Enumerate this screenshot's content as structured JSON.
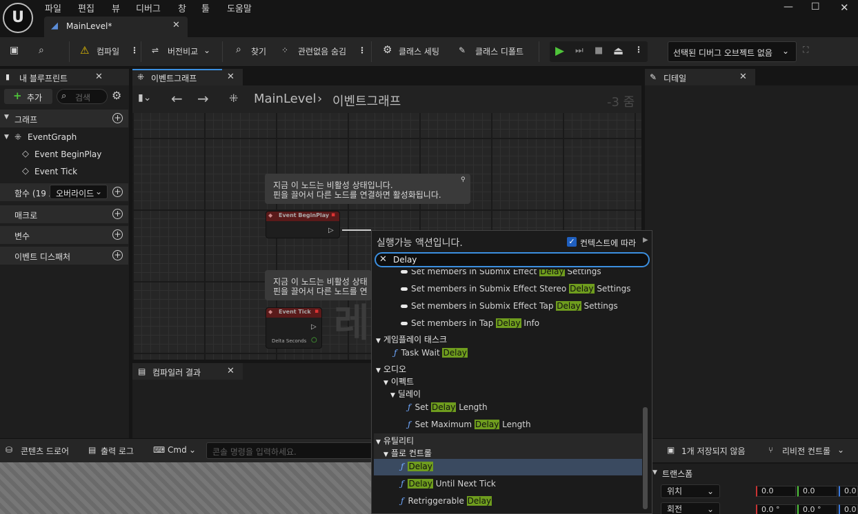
{
  "app": {
    "menu": [
      "파일",
      "편집",
      "뷰",
      "디버그",
      "창",
      "툴",
      "도움말"
    ],
    "tab_title": "MainLevel*"
  },
  "toolbar": {
    "compile": "컴파일",
    "diff": "버전비교",
    "find": "찾기",
    "hide_unrelated": "관련없음 숨김",
    "class_settings": "클래스 세팅",
    "class_defaults": "클래스 디폴트",
    "debug_object": "선택된 디버그 오브젝트 없음"
  },
  "my_blueprint": {
    "tab": "내 블루프린트",
    "add": "추가",
    "search_placeholder": "검색",
    "graphs_label": "그래프",
    "event_graph": "EventGraph",
    "events": [
      "Event BeginPlay",
      "Event Tick"
    ],
    "functions_label": "함수 (19 오",
    "override": "오버라이드",
    "macros": "매크로",
    "variables": "변수",
    "dispatchers": "이벤트 디스패처"
  },
  "graph": {
    "tab": "이벤트그래프",
    "breadcrumb_root": "MainLevel",
    "breadcrumb_leaf": "이벤트그래프",
    "zoom": "-3 줌",
    "watermark": "레",
    "comment1_line1": "지금 이 노드는 비활성 상태입니다.",
    "comment1_line2": "핀을 끌어서 다른 노드를 연결하면 활성화됩니다.",
    "comment2_line1": "지금 이 노드는 비활성 상태",
    "comment2_line2": "핀을 끌어서 다른 노드를 연",
    "node_beginplay": "Event BeginPlay",
    "node_tick": "Event Tick",
    "delta_seconds": "Delta Seconds"
  },
  "compiler": {
    "tab": "컴파일러 결과"
  },
  "details": {
    "tab": "디테일",
    "transform": "트랜스폼",
    "location": "위치",
    "rotation": "회전",
    "loc_values": [
      "0.0",
      "0.0",
      "0.0"
    ],
    "rot_values": [
      "0.0 °",
      "0.0 °",
      "0.0"
    ]
  },
  "context_menu": {
    "title": "실행가능 액션입니다.",
    "context_label": "컨텍스트에 따라",
    "search_value": "Delay",
    "highlight": "Delay",
    "items": [
      {
        "pre": "Set members in Submix Effect ",
        "post": " Settings"
      },
      {
        "pre": "Set members in Submix Effect Stereo ",
        "post": " Settings"
      },
      {
        "pre": "Set members in Submix Effect Tap ",
        "post": " Settings"
      },
      {
        "pre": "Set members in Tap ",
        "post": " Info"
      }
    ],
    "cat_gameplay_tasks": "게임플레이 태스크",
    "task_wait": {
      "pre": "Task Wait ",
      "post": ""
    },
    "cat_audio": "오디오",
    "cat_effects": "이펙트",
    "cat_delay": "딜레이",
    "set_delay_length": {
      "pre": "Set ",
      "post": " Length"
    },
    "set_max_delay_length": {
      "pre": "Set Maximum ",
      "post": " Length"
    },
    "cat_utilities": "유틸리티",
    "cat_flow_control": "플로 컨트롤",
    "delay": {
      "pre": "",
      "post": ""
    },
    "delay_until": {
      "pre": "",
      "post": " Until Next Tick"
    },
    "retriggerable": {
      "pre": "Retriggerable ",
      "post": ""
    }
  },
  "bottom": {
    "content_drawer": "콘텐츠 드로어",
    "output_log": "출력 로그",
    "cmd": "Cmd",
    "console_placeholder": "콘솔 명령을 입력하세요.",
    "unsaved": "1개 저장되지 않음",
    "revision_control": "리비전 컨트롤"
  }
}
